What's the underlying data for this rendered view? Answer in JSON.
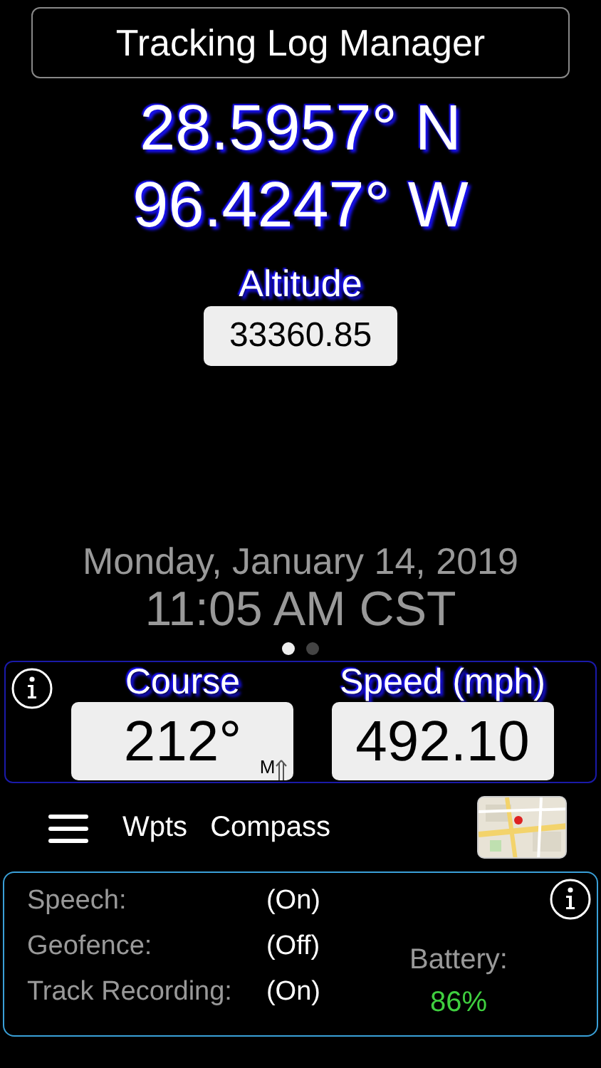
{
  "title": "Tracking Log Manager",
  "latitude": "28.5957° N",
  "longitude": "96.4247° W",
  "altitude": {
    "label": "Altitude",
    "value": "33360.85"
  },
  "date": "Monday, January 14, 2019",
  "time": "11:05 AM CST",
  "pages": [
    {
      "selected": true
    },
    {
      "selected": false
    }
  ],
  "readouts": [
    {
      "label": "Course",
      "value": "212°",
      "suffix": "M"
    },
    {
      "label": "Speed (mph)",
      "value": "492.10"
    }
  ],
  "toolbar": [
    "Wpts",
    "Compass"
  ],
  "status": [
    {
      "label": "Speech:",
      "value": "(On)"
    },
    {
      "label": "Geofence:",
      "value": "(Off)"
    },
    {
      "label": "Track Recording:",
      "value": "(On)"
    }
  ],
  "battery": {
    "label": "Battery:",
    "value": "86%"
  }
}
